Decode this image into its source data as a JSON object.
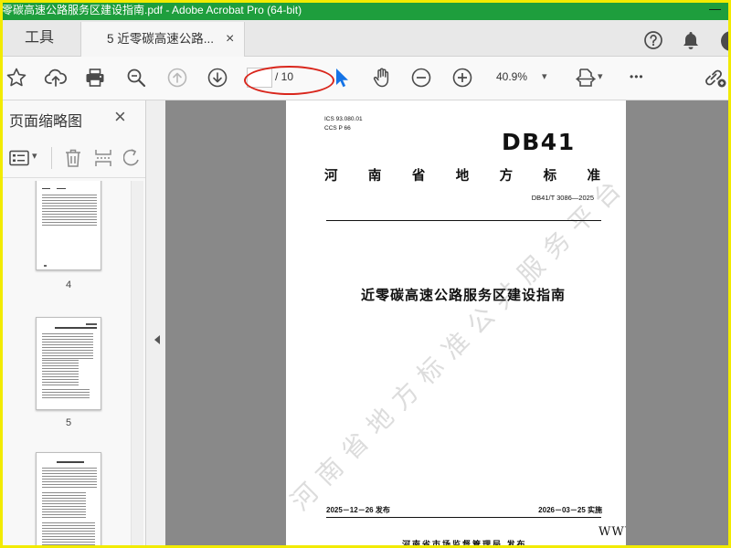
{
  "window": {
    "title": "零碳高速公路服务区建设指南.pdf - Adobe Acrobat Pro (64-bit)",
    "minimize_symbol": "—"
  },
  "tabs": {
    "tools_label": "工具",
    "document_label": "5 近零碳高速公路...",
    "close_symbol": "×"
  },
  "header_icons": [
    "help-icon",
    "bell-icon",
    "account-icon"
  ],
  "toolbar": {
    "icons": [
      "star-icon",
      "cloud-upload-icon",
      "print-icon",
      "search-zoom-out-icon",
      "previous-page-icon",
      "next-page-icon",
      "select-pointer-icon",
      "hand-tool-icon",
      "zoom-out-icon",
      "zoom-in-icon",
      "page-fit-icon",
      "share-link-icon"
    ],
    "page_number": "",
    "page_total": "/ 10",
    "zoom_value": "40.9%",
    "dropdown_symbol": "▾",
    "more_label": "•••"
  },
  "thumbnail_panel": {
    "title": "页面缩略图",
    "close_symbol": "×",
    "tool_icons": [
      "options-icon",
      "delete-page-icon",
      "insert-pages-icon",
      "rotate-page-icon"
    ],
    "thumbnails": [
      {
        "label": "4"
      },
      {
        "label": "5"
      }
    ]
  },
  "document": {
    "ics": "ICS 93.080.01",
    "ccs": "CCS P 66",
    "standard_code": "DB41",
    "standard_type": "河南省地方标准",
    "standard_number": "DB41/T 3086—2025",
    "title": "近零碳高速公路服务区建设指南",
    "issue_date": "2025－12－26 发布",
    "implement_date": "2026－03－25 实施",
    "issuer": "河南省市场监督管理局 发布",
    "watermark": "河南省地方标准公共服务平台",
    "corner_watermark": "WWW"
  },
  "colors": {
    "title_bar": "#1e9e3d",
    "frame": "#f2eb00",
    "accent": "#1473e6",
    "annotation": "#d9261c",
    "workspace": "#898989"
  }
}
